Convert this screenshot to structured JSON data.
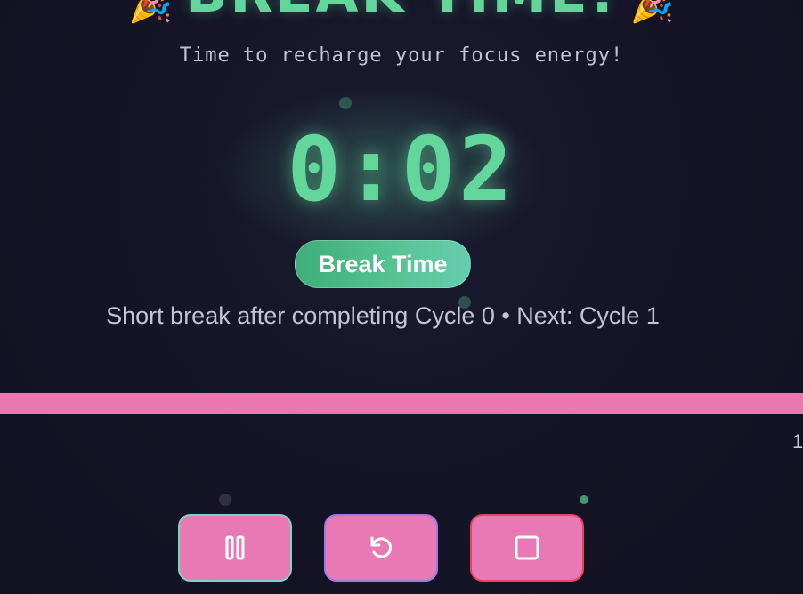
{
  "header": {
    "title": "BREAK TIME!",
    "emoji": "🎉",
    "subtitle": "Time to recharge your focus energy!"
  },
  "timer": {
    "display": "0:02"
  },
  "mode_badge": {
    "label": "Break Time"
  },
  "session_info": {
    "text": "Short break after completing Cycle 0 • Next: Cycle 1"
  },
  "progress": {
    "fraction": 1.0,
    "side_label": "1"
  },
  "controls": {
    "pause": {
      "icon": "pause-icon"
    },
    "restart": {
      "icon": "restart-icon"
    },
    "stop": {
      "icon": "stop-icon"
    }
  },
  "colors": {
    "accent_green": "#63d69c",
    "accent_pink": "#ea77b2",
    "background": "#141426"
  }
}
